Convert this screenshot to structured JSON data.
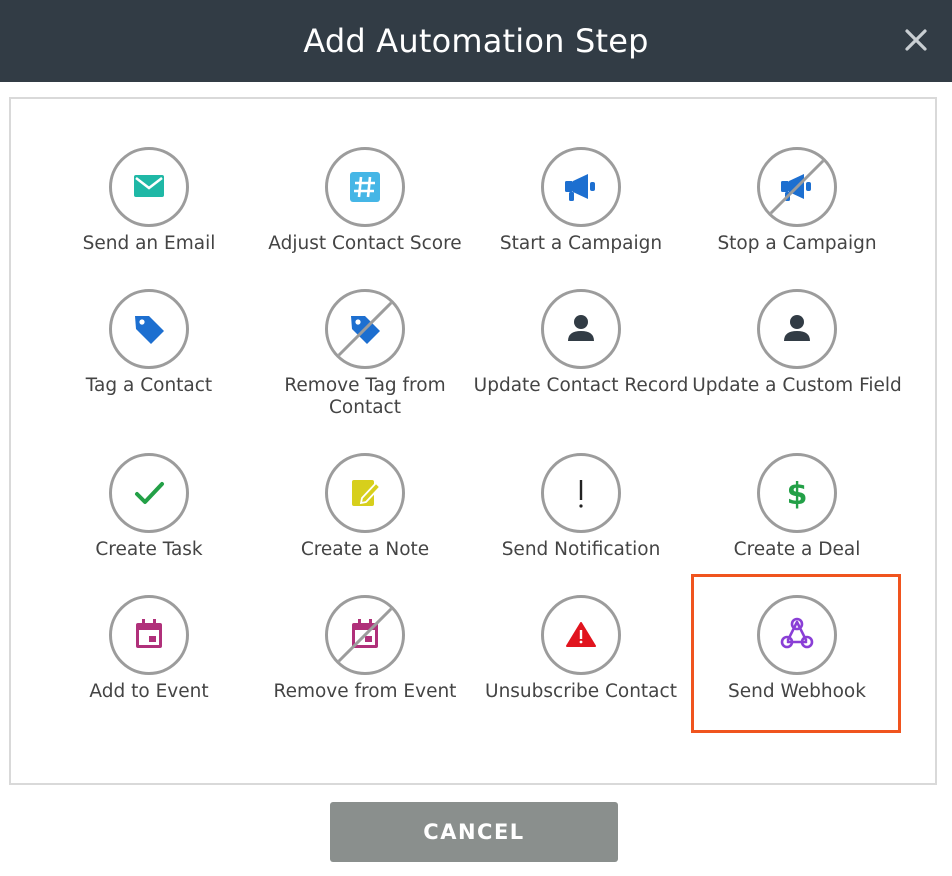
{
  "modal": {
    "title": "Add Automation Step",
    "cancel_label": "CANCEL"
  },
  "steps": [
    {
      "label": "Send an Email",
      "icon": "envelope-icon"
    },
    {
      "label": "Adjust Contact Score",
      "icon": "hashtag-icon"
    },
    {
      "label": "Start a Campaign",
      "icon": "megaphone-icon"
    },
    {
      "label": "Stop a Campaign",
      "icon": "megaphone-slash-icon"
    },
    {
      "label": "Tag a Contact",
      "icon": "tag-icon"
    },
    {
      "label": "Remove Tag from Contact",
      "icon": "tag-slash-icon"
    },
    {
      "label": "Update Contact Record",
      "icon": "person-icon"
    },
    {
      "label": "Update a Custom Field",
      "icon": "person-icon"
    },
    {
      "label": "Create Task",
      "icon": "checkmark-icon"
    },
    {
      "label": "Create a Note",
      "icon": "note-edit-icon"
    },
    {
      "label": "Send Notification",
      "icon": "exclamation-icon"
    },
    {
      "label": "Create a Deal",
      "icon": "dollar-icon"
    },
    {
      "label": "Add to Event",
      "icon": "calendar-icon"
    },
    {
      "label": "Remove from Event",
      "icon": "calendar-slash-icon"
    },
    {
      "label": "Unsubscribe Contact",
      "icon": "warning-icon"
    },
    {
      "label": "Send Webhook",
      "icon": "webhook-icon",
      "highlighted": true
    }
  ],
  "colors": {
    "header_bg": "#323c45",
    "email": "#1fb8a6",
    "hashtag": "#45b6e6",
    "campaign": "#1d6fd0",
    "tag": "#1d6fd0",
    "person": "#323c45",
    "check": "#23a047",
    "note": "#d7cf1c",
    "dollar": "#23a047",
    "calendar": "#b0307a",
    "warning": "#e1141e",
    "webhook": "#8a3fd6",
    "highlight": "#f0541e",
    "cancel_bg": "#8a8f8d"
  }
}
